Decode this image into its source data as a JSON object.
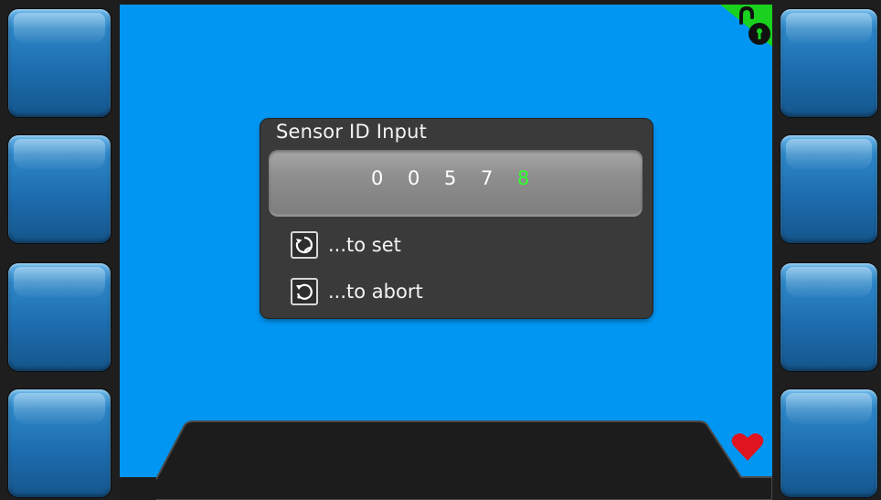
{
  "dialog": {
    "title": "Sensor ID Input",
    "digits": [
      "0",
      "0",
      "5",
      "7",
      "8"
    ],
    "active_digit_index": 4,
    "set_hint": "...to set",
    "abort_hint": "...to abort"
  },
  "softkeys": {
    "left": [
      "",
      "",
      "",
      ""
    ],
    "right": [
      "",
      "",
      "",
      ""
    ]
  },
  "status": {
    "lock_icon": "unlocked-padlock-icon",
    "heart_icon": "heart-icon"
  },
  "colors": {
    "screen_background": "#0096f2",
    "active_digit": "#2eff2e",
    "lock_badge": "#19d11e",
    "heart": "#e0141e"
  }
}
